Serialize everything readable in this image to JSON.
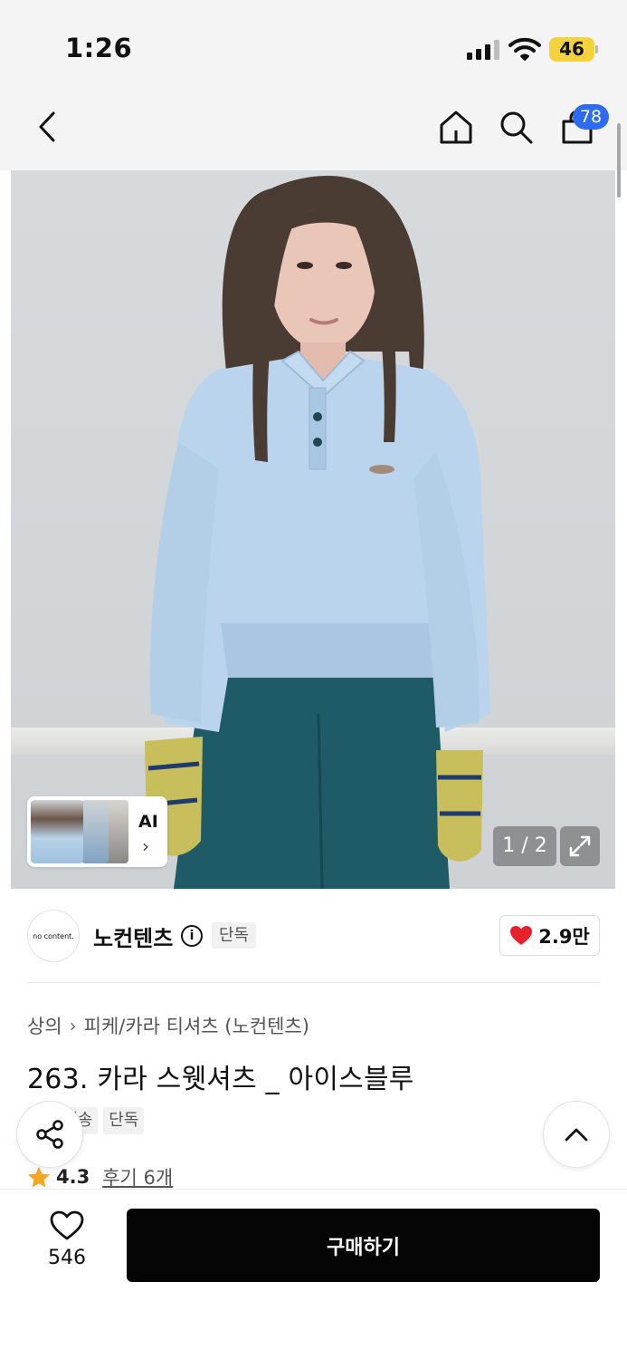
{
  "status_bar": {
    "time": "1:26",
    "battery": "46"
  },
  "nav": {
    "cart_count": "78"
  },
  "gallery": {
    "ai_label": "AI",
    "page_indicator": "1 / 2"
  },
  "brand": {
    "logo_text": "no content.",
    "name": "노컨텐츠",
    "info_icon": "i",
    "badge": "단독",
    "likes": "2.9만"
  },
  "product": {
    "breadcrumb": [
      "상의",
      "피케/카라 티셔츠 (노컨텐츠)"
    ],
    "title": "263. 카라 스웻셔츠 _ 아이스블루",
    "tags": [
      "무료배송",
      "단독"
    ],
    "rating": "4.3",
    "reviews_label": "후기 6개"
  },
  "bottom_bar": {
    "wish_count": "546",
    "buy_label": "구매하기"
  },
  "colors": {
    "accent_blue": "#2f6bf2",
    "battery_yellow": "#f3d33c",
    "heart_red": "#e8202a",
    "star_orange": "#f5a623",
    "buy_button": "#050505"
  },
  "icons": [
    "back-icon",
    "home-icon",
    "search-icon",
    "cart-icon",
    "expand-icon",
    "info-icon",
    "heart-icon",
    "star-icon",
    "share-icon",
    "chevron-up-icon"
  ]
}
